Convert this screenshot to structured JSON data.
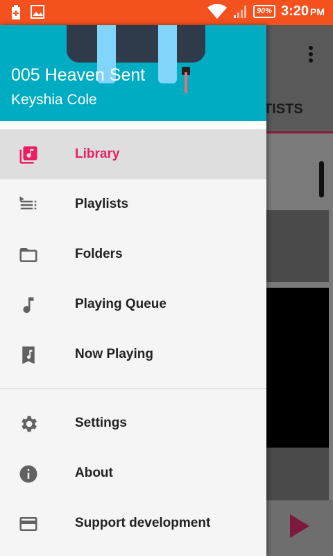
{
  "status_bar": {
    "battery": "90%",
    "time": "3:20",
    "ampm": "PM"
  },
  "background": {
    "tab_label": "TISTS"
  },
  "drawer": {
    "now_playing_title": "005 Heaven Sent",
    "now_playing_artist": "Keyshia Cole",
    "menu_items": [
      {
        "label": "Library",
        "icon": "library-music-icon",
        "active": true
      },
      {
        "label": "Playlists",
        "icon": "playlist-icon"
      },
      {
        "label": "Folders",
        "icon": "folder-icon"
      },
      {
        "label": "Playing Queue",
        "icon": "music-note-icon"
      },
      {
        "label": "Now Playing",
        "icon": "music-bookmark-icon"
      }
    ],
    "secondary_items": [
      {
        "label": "Settings",
        "icon": "settings-gear-icon"
      },
      {
        "label": "About",
        "icon": "info-icon"
      },
      {
        "label": "Support development",
        "icon": "credit-card-icon"
      }
    ],
    "accent_color": "#e91e63",
    "header_color": "#00acc1"
  }
}
